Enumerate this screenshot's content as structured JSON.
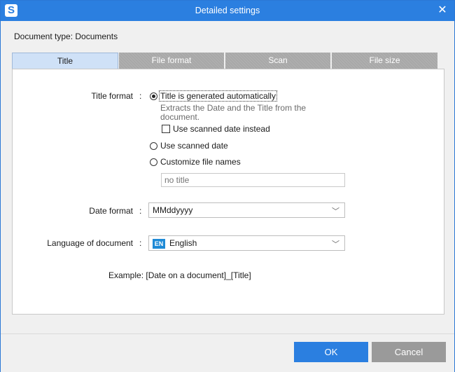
{
  "window": {
    "title": "Detailed settings",
    "accent_color": "#2b7fe0",
    "app_icon": "scansnap-icon",
    "app_icon_glyph": "S",
    "close_glyph": "✕"
  },
  "document_type": "Document type: Documents",
  "tabs": [
    {
      "label": "Title",
      "active": true
    },
    {
      "label": "File format",
      "active": false
    },
    {
      "label": "Scan",
      "active": false
    },
    {
      "label": "File size",
      "active": false
    }
  ],
  "title_format": {
    "label": "Title format",
    "colon": ":",
    "options": [
      {
        "label": "Title is generated automatically",
        "selected": true
      },
      {
        "label": "Use scanned date",
        "selected": false
      },
      {
        "label": "Customize file names",
        "selected": false
      }
    ],
    "auto_description": "Extracts the Date and the Title from the document.",
    "use_scanned_date_instead": {
      "label": "Use scanned date instead",
      "checked": false
    },
    "custom_name_placeholder": "no title"
  },
  "date_format": {
    "label": "Date format",
    "colon": ":",
    "value": "MMddyyyy",
    "chevron": "﹀"
  },
  "language": {
    "label": "Language of document",
    "colon": ":",
    "badge": "EN",
    "value": "English",
    "chevron": "﹀"
  },
  "example": "Example: [Date on a document]_[Title]",
  "buttons": {
    "ok": {
      "label": "OK",
      "color": "#2b7fe0"
    },
    "cancel": {
      "label": "Cancel",
      "color": "#9a9a9a"
    }
  }
}
